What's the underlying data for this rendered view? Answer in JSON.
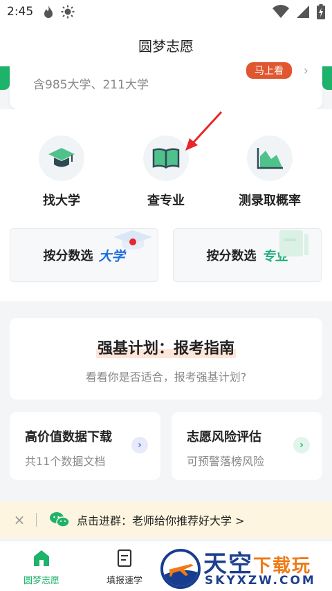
{
  "status_bar": {
    "time": "2:45"
  },
  "header": {
    "title": "圆梦志愿"
  },
  "top_card": {
    "subtitle": "含985大学、211大学",
    "button_label": "马上看",
    "arrow": "›"
  },
  "tools": [
    {
      "label": "找大学",
      "icon": "graduation-cap-icon"
    },
    {
      "label": "查专业",
      "icon": "open-book-icon"
    },
    {
      "label": "测录取概率",
      "icon": "area-chart-icon"
    }
  ],
  "score_cards": [
    {
      "label": "按分数选",
      "accent": "大学",
      "accent_color": "#1e6fe0"
    },
    {
      "label": "按分数选",
      "accent": "专业",
      "accent_color": "#20b07a"
    }
  ],
  "qiangji": {
    "title": "强基计划：报考指南",
    "subtitle": "看看你是否适合，报考强基计划?"
  },
  "mini_cards": [
    {
      "title": "高价值数据下载",
      "subtitle": "共11个数据文档",
      "arrow_color": "#5b6fd8",
      "arrow_bg": "#e7eafa"
    },
    {
      "title": "志愿风险评估",
      "subtitle": "可预警落榜风险",
      "arrow_color": "#1db36b",
      "arrow_bg": "#e2f5ec"
    }
  ],
  "promo": {
    "close": "×",
    "text": "点击进群：老师给你推荐好大学 >"
  },
  "tabs": [
    {
      "label": "圆梦志愿",
      "active": true
    },
    {
      "label": "填报速学",
      "active": false
    }
  ],
  "watermark": {
    "brand_main": "天空",
    "brand_accent": "下载玩",
    "domain": "SKYXZW.COM"
  },
  "colors": {
    "primary_green": "#1db36b",
    "promo_bg": "#fdf5e0",
    "badge_orange": "#e0562f"
  }
}
